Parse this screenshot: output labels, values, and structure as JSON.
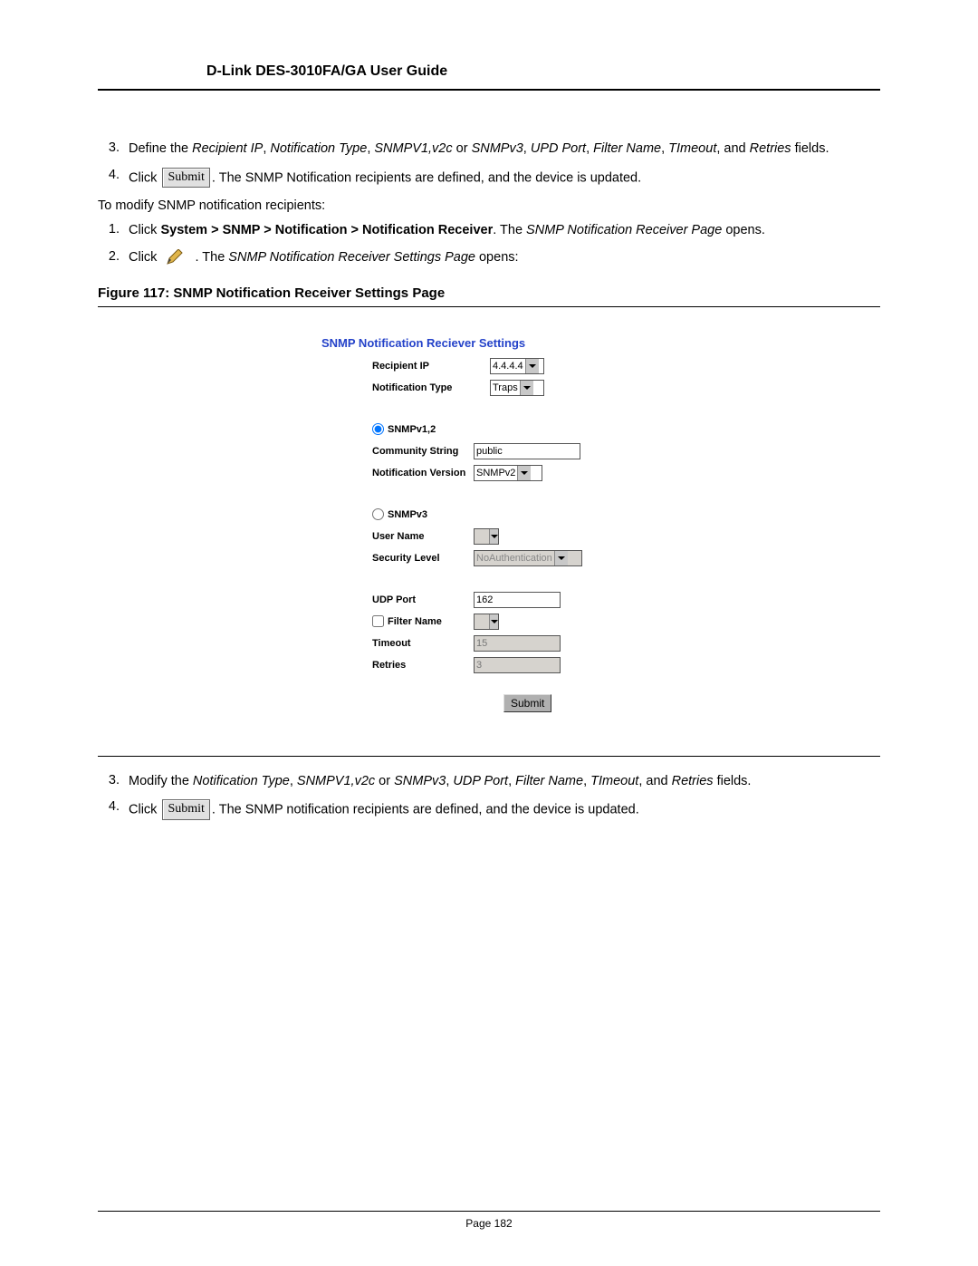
{
  "header": {
    "title": "D-Link DES-3010FA/GA User Guide"
  },
  "top_steps": {
    "s3": {
      "num": "3.",
      "a": "Define the ",
      "b": "Recipient IP",
      "c": ", ",
      "d": "Notification Type",
      "e": ", ",
      "f": "SNMPV1,v2c",
      "g": " or ",
      "h": "SNMPv3",
      "i": ", ",
      "j": "UPD Port",
      "k": ", ",
      "l": "Filter Name",
      "m": ", ",
      "n": "TImeout",
      "o": ", and ",
      "p": "Retries",
      "q": " fields."
    },
    "s4": {
      "num": "4.",
      "a": "Click ",
      "btn": "Submit",
      "b": ". The SNMP Notification recipients are defined, and the device is updated."
    }
  },
  "modify_intro": "To modify SNMP notification recipients:",
  "modify_steps": {
    "s1": {
      "num": "1.",
      "a": "Click ",
      "b": "System > SNMP > Notification > Notification Receiver",
      "c": ". The ",
      "d": "SNMP Notification Receiver Page",
      "e": " opens."
    },
    "s2": {
      "num": "2.",
      "a": "Click ",
      "b": ". The ",
      "c": "SNMP Notification Receiver Settings Page",
      "d": " opens:"
    }
  },
  "figure_caption": "Figure 117: SNMP Notification Receiver Settings Page",
  "panel": {
    "title": "SNMP Notification Reciever Settings",
    "recipient_ip_label": "Recipient IP",
    "recipient_ip_value": "4.4.4.4",
    "notification_type_label": "Notification Type",
    "notification_type_value": "Traps",
    "radio_v12_label": "SNMPv1,2",
    "community_string_label": "Community String",
    "community_string_value": "public",
    "notification_version_label": "Notification Version",
    "notification_version_value": "SNMPv2",
    "radio_v3_label": "SNMPv3",
    "user_name_label": "User Name",
    "user_name_value": "",
    "security_level_label": "Security Level",
    "security_level_value": "NoAuthentication",
    "udp_port_label": "UDP Port",
    "udp_port_value": "162",
    "filter_name_label": "Filter Name",
    "filter_name_value": "",
    "timeout_label": "Timeout",
    "timeout_value": "15",
    "retries_label": "Retries",
    "retries_value": "3",
    "submit_label": "Submit"
  },
  "bottom_steps": {
    "s3": {
      "num": "3.",
      "a": "Modify the ",
      "b": "Notification Type",
      "c": ", ",
      "d": "SNMPV1,v2c",
      "e": " or ",
      "f": "SNMPv3",
      "g": ", ",
      "h": "UDP Port",
      "i": ", ",
      "j": "Filter Name",
      "k": ", ",
      "l": "TImeout",
      "m": ", and ",
      "n": "Retries",
      "o": " fields."
    },
    "s4": {
      "num": "4.",
      "a": "Click ",
      "btn": "Submit",
      "b": ". The SNMP notification recipients are defined, and the device is updated."
    }
  },
  "page_footer": "Page 182"
}
